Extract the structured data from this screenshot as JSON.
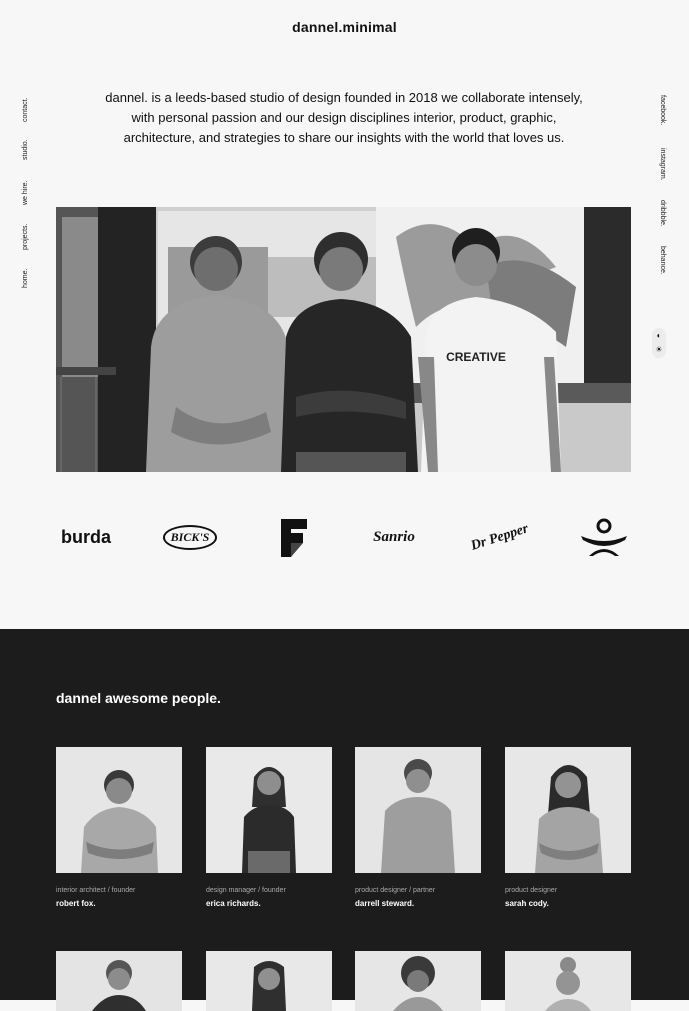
{
  "header": {
    "brand": "dannel.minimal"
  },
  "intro": "dannel. is a leeds-based studio of design founded in 2018 we collaborate intensely, with personal passion and our design disciplines interior, product, graphic, architecture, and strategies to share our insights with the world that loves us.",
  "left_nav": [
    "home.",
    "projects.",
    "we hire.",
    "studio.",
    "contact."
  ],
  "right_nav": [
    "facebook.",
    "instagram.",
    "dribbble.",
    "behance."
  ],
  "theme_toggle": {
    "dark_icon": "moon-icon",
    "light_icon": "sun-icon",
    "dark_glyph": "◐",
    "light_glyph": "☀"
  },
  "hero": {
    "shirt_text": "CREATIVE"
  },
  "clients": [
    {
      "name": "burda",
      "text": "burda"
    },
    {
      "name": "bicks",
      "text": "BICK'S"
    },
    {
      "name": "f-mark",
      "text": ""
    },
    {
      "name": "sanrio",
      "text": "Sanrio"
    },
    {
      "name": "dr-pepper",
      "text": "Dr Pepper"
    },
    {
      "name": "figure-mark",
      "text": ""
    }
  ],
  "team": {
    "title": "dannel awesome people.",
    "members": [
      {
        "role": "interior architect / founder",
        "name": "robert fox."
      },
      {
        "role": "design manager / founder",
        "name": "erica richards."
      },
      {
        "role": "product designer / partner",
        "name": "darrell steward."
      },
      {
        "role": "product designer",
        "name": "sarah cody."
      }
    ]
  },
  "colors": {
    "background": "#f7f7f7",
    "dark_section": "#1c1c1c",
    "text": "#111111",
    "muted": "#aaaaaa"
  }
}
